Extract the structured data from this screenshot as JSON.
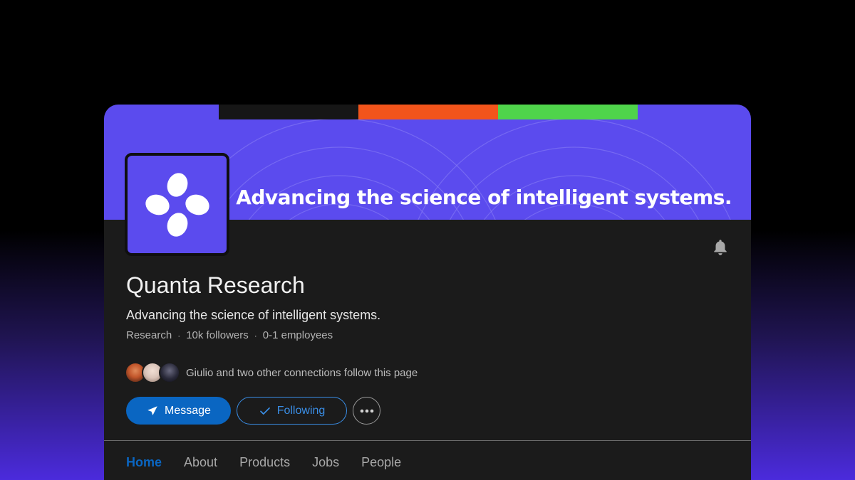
{
  "banner": {
    "tagline": "Advancing the science of intelligent systems.",
    "stripe_colors": [
      "#161616",
      "#f2541b",
      "#4fd44b"
    ]
  },
  "company": {
    "name": "Quanta Research",
    "tagline": "Advancing the science of intelligent systems.",
    "industry": "Research",
    "followers": "10k followers",
    "employees": "0-1 employees"
  },
  "connections": {
    "text": "Giulio and two other connections follow this page",
    "avatar_colors": [
      "#c2562b",
      "#d9c3b8",
      "#2a2a3a"
    ]
  },
  "actions": {
    "message_label": "Message",
    "following_label": "Following"
  },
  "tabs": [
    {
      "label": "Home",
      "active": true
    },
    {
      "label": "About",
      "active": false
    },
    {
      "label": "Products",
      "active": false
    },
    {
      "label": "Jobs",
      "active": false
    },
    {
      "label": "People",
      "active": false
    }
  ],
  "colors": {
    "brand_purple": "#5b4bee",
    "primary_blue": "#0a66c2",
    "card_bg": "#1b1b1b"
  }
}
